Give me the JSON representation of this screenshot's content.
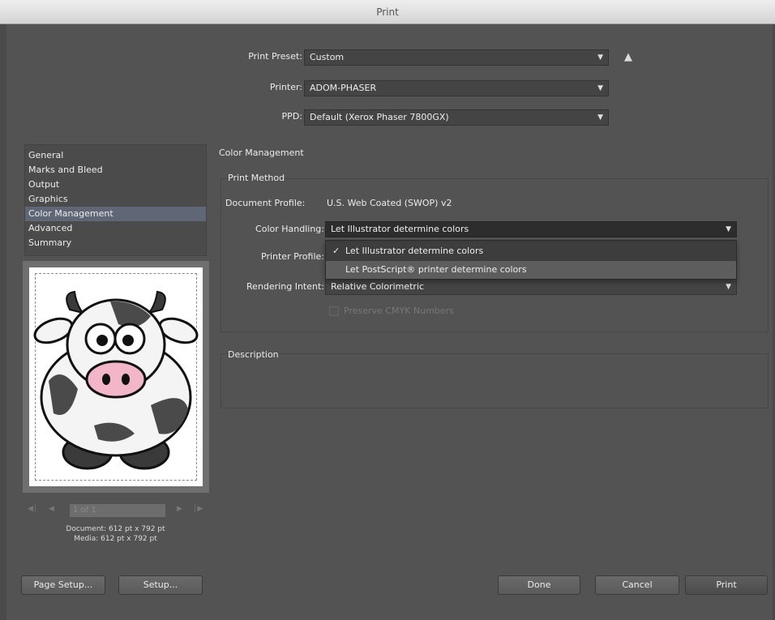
{
  "window": {
    "title": "Print"
  },
  "header": {
    "print_preset": {
      "label": "Print Preset:",
      "value": "Custom"
    },
    "printer": {
      "label": "Printer:",
      "value": "ADOM-PHASER"
    },
    "ppd": {
      "label": "PPD:",
      "value": "Default (Xerox Phaser 7800GX)"
    }
  },
  "sidebar": {
    "items": [
      {
        "label": "General"
      },
      {
        "label": "Marks and Bleed"
      },
      {
        "label": "Output"
      },
      {
        "label": "Graphics"
      },
      {
        "label": "Color Management",
        "selected": true
      },
      {
        "label": "Advanced"
      },
      {
        "label": "Summary"
      }
    ],
    "page_nav": {
      "page_field": "1 of 1"
    },
    "document_size": "Document: 612 pt x 792 pt",
    "media_size": "Media: 612 pt x 792 pt"
  },
  "main": {
    "section_title": "Color Management",
    "print_method": {
      "title": "Print Method",
      "document_profile_label": "Document Profile:",
      "document_profile_value": "U.S. Web Coated (SWOP) v2",
      "color_handling_label": "Color Handling:",
      "color_handling_value": "Let Illustrator determine colors",
      "color_handling_options": [
        "Let Illustrator determine colors",
        "Let PostScript® printer determine colors"
      ],
      "printer_profile_label": "Printer Profile:",
      "rendering_intent_label": "Rendering Intent:",
      "rendering_intent_value": "Relative Colorimetric",
      "preserve_cmyk_label": "Preserve CMYK Numbers"
    },
    "description": {
      "title": "Description"
    }
  },
  "footer": {
    "page_setup": "Page Setup...",
    "setup": "Setup...",
    "done": "Done",
    "cancel": "Cancel",
    "print": "Print"
  },
  "colors": {
    "background": "#535353",
    "selection": "#5f6675",
    "menu_highlight": "#5d5d5d"
  },
  "icons": [
    "save-preset-icon",
    "dropdown-arrow-icon",
    "checkmark-icon",
    "first-page-icon",
    "prev-page-icon",
    "next-page-icon",
    "last-page-icon"
  ]
}
